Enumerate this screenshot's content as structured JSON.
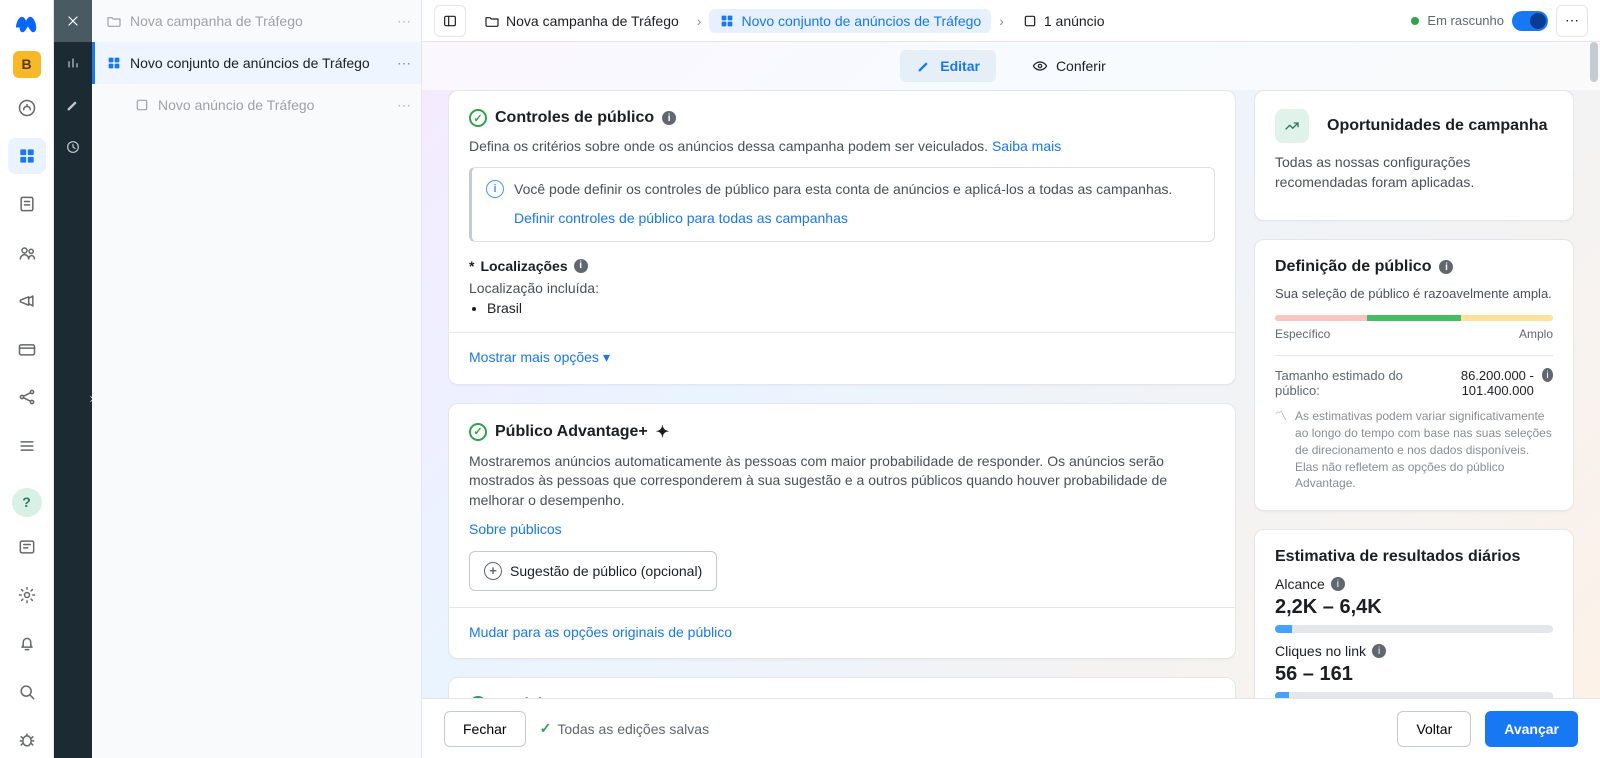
{
  "rail": {
    "app_badge": "B"
  },
  "tree": {
    "campaign": "Nova campanha de Tráfego",
    "adset": "Novo conjunto de anúncios de Tráfego",
    "ad": "Novo anúncio de Tráfego"
  },
  "breadcrumb": {
    "campaign": "Nova campanha de Tráfego",
    "adset": "Novo conjunto de anúncios de Tráfego",
    "ads": "1 anúncio"
  },
  "status": "Em rascunho",
  "tabs": {
    "edit": "Editar",
    "review": "Conferir"
  },
  "audience_controls": {
    "title": "Controles de público",
    "desc": "Defina os critérios sobre onde os anúncios dessa campanha podem ser veiculados.",
    "learn": "Saiba mais",
    "note": "Você pode definir os controles de público para esta conta de anúncios e aplicá-los a todas as campanhas.",
    "note_link": "Definir controles de público para todas as campanhas",
    "locations_label": "Localizações",
    "location_included_label": "Localização incluída:",
    "location_value": "Brasil",
    "more_options": "Mostrar mais opções"
  },
  "advantage": {
    "title": "Público Advantage+",
    "desc": "Mostraremos anúncios automaticamente às pessoas com maior probabilidade de responder. Os anúncios serão mostrados às pessoas que corresponderem à sua sugestão e a outros públicos quando houver probabilidade de melhorar o desempenho.",
    "about": "Sobre públicos",
    "suggestion_btn": "Sugestão de público (opcional)",
    "switch": "Mudar para as opções originais de público"
  },
  "placements": {
    "title": "Posicionamentos"
  },
  "opportunities": {
    "title": "Oportunidades de campanha",
    "body": "Todas as nossas configurações recomendadas foram aplicadas."
  },
  "definition": {
    "title": "Definição de público",
    "sub": "Sua seleção de público é razoavelmente ampla.",
    "specific": "Específico",
    "broad": "Amplo",
    "size_label": "Tamanho estimado do público:",
    "size_value": "86.200.000 - 101.400.000",
    "disclaimer": "As estimativas podem variar significativamente ao longo do tempo com base nas suas seleções de direcionamento e nos dados disponíveis. Elas não refletem as opções do público Advantage."
  },
  "daily": {
    "title": "Estimativa de resultados diários",
    "reach_label": "Alcance",
    "reach_value": "2,2K – 6,4K",
    "clicks_label": "Cliques no link",
    "clicks_value": "56 – 161"
  },
  "footer": {
    "close": "Fechar",
    "saved": "Todas as edições salvas",
    "back": "Voltar",
    "next": "Avançar"
  }
}
